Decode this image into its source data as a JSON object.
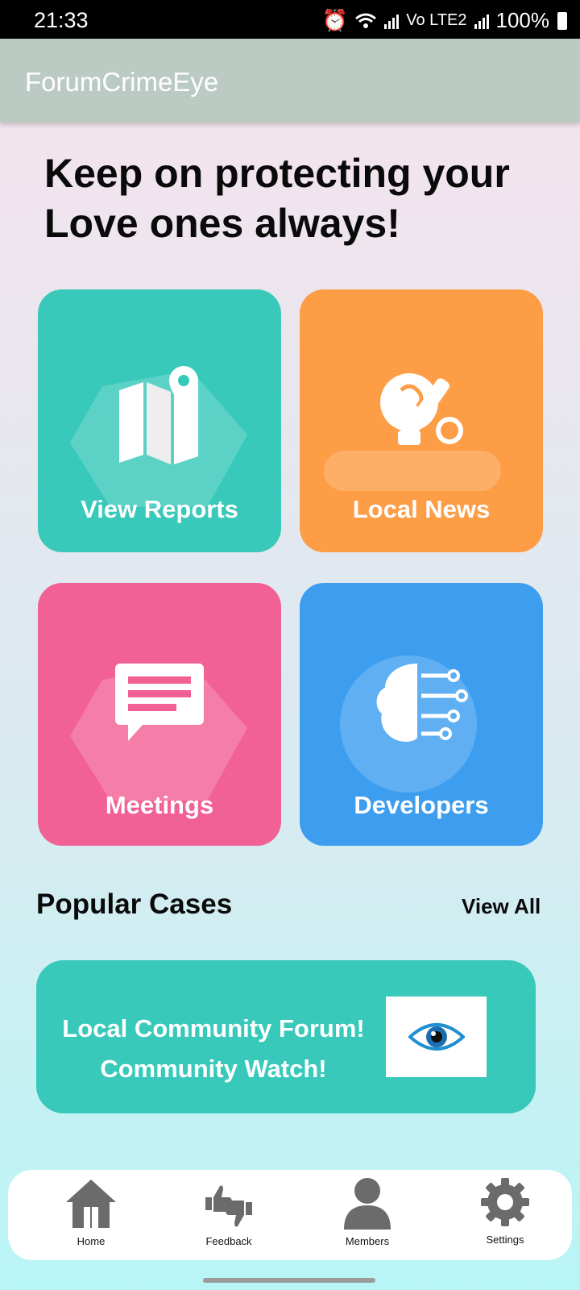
{
  "status": {
    "time": "21:33",
    "battery": "100%",
    "network_small": "Vo LTE2"
  },
  "appbar": {
    "title": "ForumCrimeEye",
    "color": "#bccac4"
  },
  "headline": "Keep on protecting your Love ones always!",
  "tiles": [
    {
      "label": "View Reports",
      "color": "#38c9bb",
      "icon": "map-pin-icon"
    },
    {
      "label": "Local News",
      "color": "#fd9d45",
      "icon": "idea-pencil-icon"
    },
    {
      "label": "Meetings",
      "color": "#f26195",
      "icon": "chat-message-icon"
    },
    {
      "label": "Developers",
      "color": "#3d9ef0",
      "icon": "brain-circuit-icon"
    }
  ],
  "popular": {
    "title": "Popular Cases",
    "view_all": "View All",
    "card": {
      "line1": "Local Community Forum!",
      "line2": "Community Watch!",
      "image_icon": "eye-icon",
      "color": "#38c9bb"
    }
  },
  "nav": [
    {
      "label": "Home",
      "icon": "home-icon"
    },
    {
      "label": "Feedback",
      "icon": "thumbs-up-down-icon"
    },
    {
      "label": "Members",
      "icon": "person-icon"
    },
    {
      "label": "Settings",
      "icon": "gear-icon"
    }
  ]
}
